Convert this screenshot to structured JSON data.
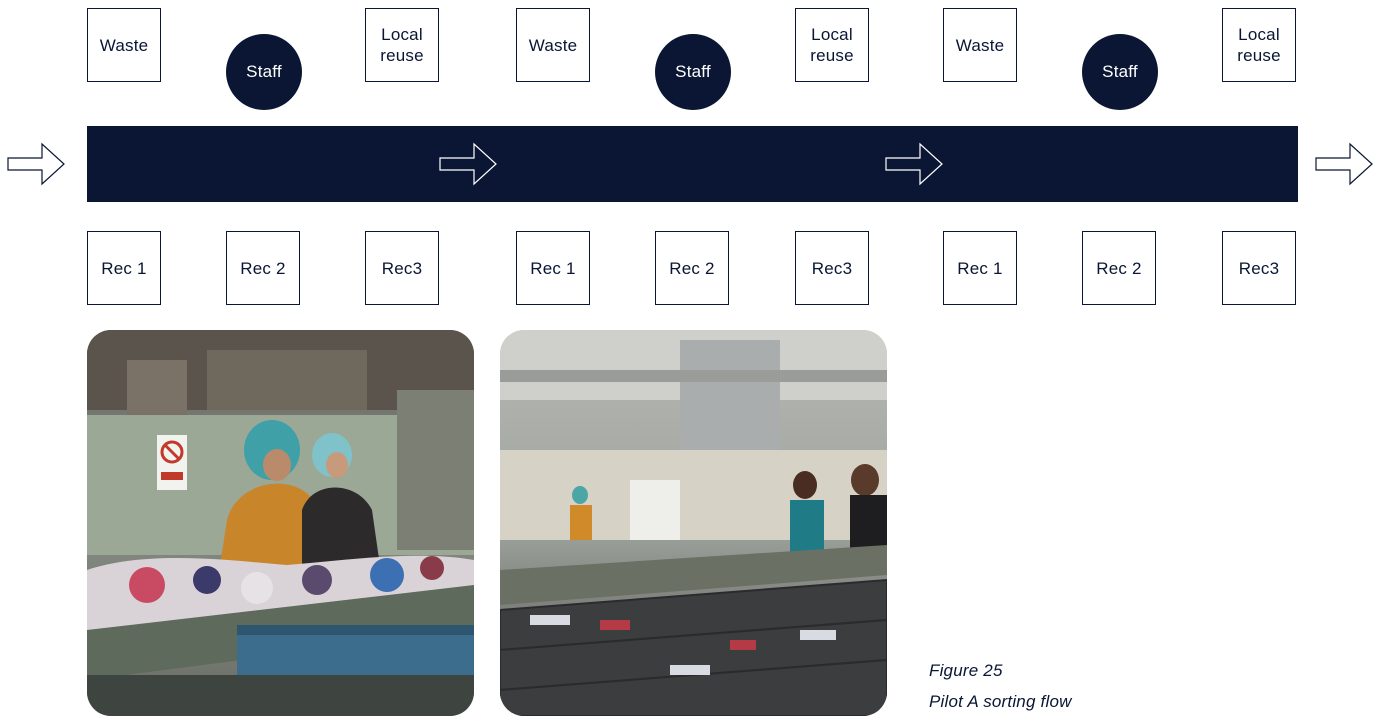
{
  "colors": {
    "navy": "#0a1633"
  },
  "top_row": [
    {
      "kind": "box",
      "label": "Waste"
    },
    {
      "kind": "circle",
      "label": "Staff"
    },
    {
      "kind": "box",
      "label": "Local\nreuse"
    },
    {
      "kind": "box",
      "label": "Waste"
    },
    {
      "kind": "circle",
      "label": "Staff"
    },
    {
      "kind": "box",
      "label": "Local\nreuse"
    },
    {
      "kind": "box",
      "label": "Waste"
    },
    {
      "kind": "circle",
      "label": "Staff"
    },
    {
      "kind": "box",
      "label": "Local\nreuse"
    }
  ],
  "bottom_row": [
    "Rec 1",
    "Rec 2",
    "Rec3",
    "Rec 1",
    "Rec 2",
    "Rec3",
    "Rec 1",
    "Rec 2",
    "Rec3"
  ],
  "arrows": [
    "arrow-right-icon",
    "arrow-right-icon",
    "arrow-right-icon",
    "arrow-right-icon"
  ],
  "photos": [
    "sorting-workers-photo",
    "sorting-hall-photo"
  ],
  "caption": {
    "figure": "Figure 25",
    "title": "Pilot A sorting flow"
  }
}
